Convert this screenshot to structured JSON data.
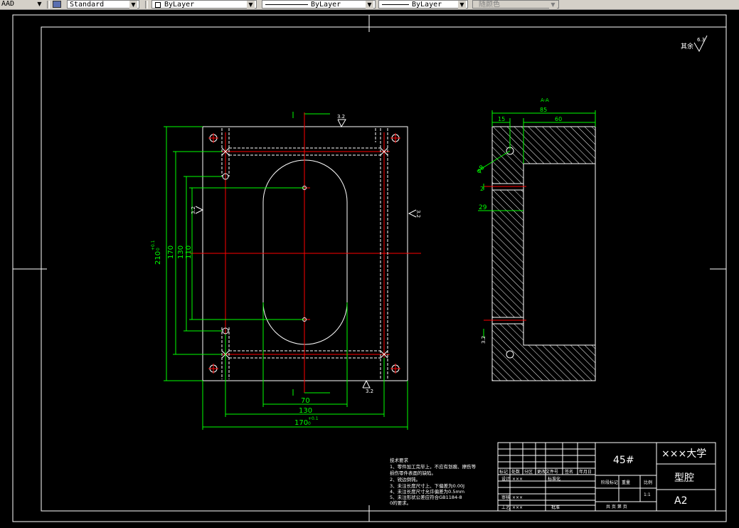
{
  "toolbar": {
    "left_text": "AAD",
    "text_style": "Standard",
    "layer": "ByLayer",
    "linetype": "ByLayer",
    "lineweight": "ByLayer",
    "color": "随颜色"
  },
  "drawing": {
    "roughness_note_prefix": "其余",
    "roughness_note_value": "6.3",
    "roughness_32": "3.2",
    "front": {
      "dim_210": "210",
      "dim_210_tol": "+0.1",
      "dim_210_tol0": "0",
      "dim_170v": "170",
      "dim_130v": "130",
      "dim_110v": "110",
      "dim_70": "70",
      "dim_130": "130",
      "dim_170": "170",
      "dim_170_tol": "+0.1",
      "dim_170_tol0": "0"
    },
    "side": {
      "label_aa": "A-A",
      "dim_85": "85",
      "dim_15": "15",
      "dim_60": "60",
      "dim_phi8": "φ8",
      "dim_29": "29",
      "dim_2": "2"
    },
    "tech_req": {
      "title": "技术要求",
      "lines": [
        "1、零件加工完毕上，不应有划痕、擦伤等",
        "   损伤零件表面的缺陷。",
        "2、锐边倒钝。",
        "3、未注长度尺寸上、下偏差为0.00J",
        "4、未注长度尺寸允许偏差为0.5mm",
        "5、未注形状公差应符合GB1184-8",
        "   0的要求。"
      ]
    },
    "title_block": {
      "material": "45#",
      "school": "×××大学",
      "part_name": "型腔",
      "sheet": "A2",
      "row_labels": [
        "标记",
        "处数",
        "分区",
        "更改文件号",
        "签名",
        "年月日"
      ],
      "designer_label": "设计",
      "designer": "×××",
      "standard_label": "标准化",
      "checker_label": "审核",
      "checker": "×××",
      "craft_label": "工艺",
      "craft": "×××",
      "approve_label": "批准",
      "stage_label": "阶段标记",
      "weight_label": "重量",
      "scale_label": "比例",
      "scale": "1:1",
      "sheets_text": "共  页  第  页"
    }
  }
}
